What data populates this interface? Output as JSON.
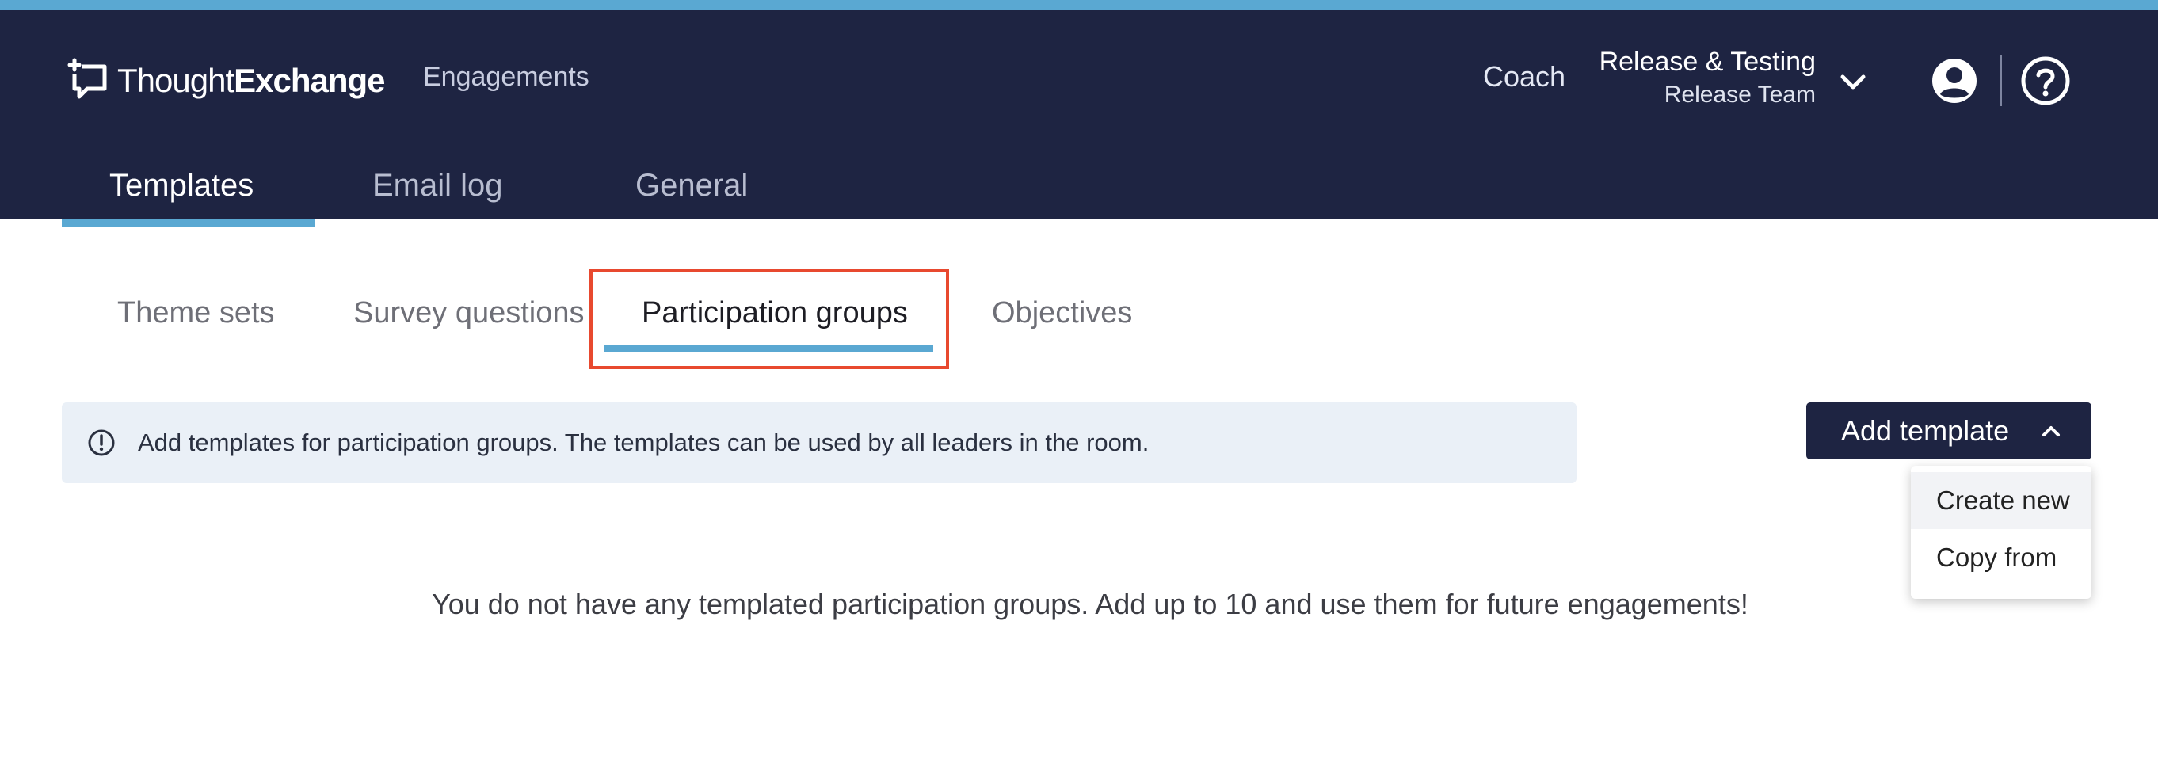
{
  "brand": {
    "name_light": "Thought",
    "name_bold": "Exchange",
    "accent": "#5aa8d2",
    "header_bg": "#1e2442"
  },
  "header": {
    "nav_engagements": "Engagements",
    "coach_label": "Coach",
    "room_name": "Release & Testing",
    "room_team": "Release Team"
  },
  "main_tabs": [
    {
      "label": "Templates",
      "active": true
    },
    {
      "label": "Email log",
      "active": false
    },
    {
      "label": "General",
      "active": false
    }
  ],
  "sub_tabs": [
    {
      "label": "Theme sets",
      "active": false
    },
    {
      "label": "Survey questions",
      "active": false
    },
    {
      "label": "Participation groups",
      "active": true
    },
    {
      "label": "Objectives",
      "active": false
    }
  ],
  "info_banner": {
    "text": "Add templates for participation groups. The templates can be used by all leaders in the room."
  },
  "add_template": {
    "label": "Add template",
    "menu": [
      {
        "label": "Create new"
      },
      {
        "label": "Copy from"
      }
    ]
  },
  "empty_state": "You do not have any templated participation groups. Add up to 10 and use them for future engagements!",
  "icons": {
    "logo": "chat-bubble-plus-icon",
    "chevron": "chevron-down-icon",
    "user": "user-circle-icon",
    "help": "question-circle-icon",
    "info": "info-circle-icon"
  }
}
